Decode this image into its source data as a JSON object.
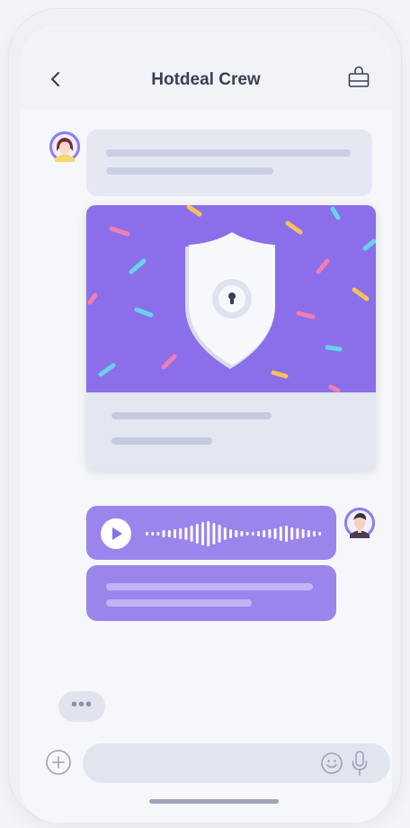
{
  "header": {
    "title": "Hotdeal Crew"
  },
  "icons": {
    "back": "chevron-left-icon",
    "bag": "shopping-bag-icon",
    "play": "play-icon",
    "add": "plus-icon",
    "emoji": "smiley-icon",
    "mic": "microphone-icon",
    "shield": "shield-lock-icon"
  },
  "composer": {
    "typing_indicator": "•••"
  },
  "colors": {
    "accent": "#9b84ec",
    "card_art": "#8b6fea",
    "bubble_gray": "#e5e8f2",
    "text_dark": "#3a3f56"
  }
}
